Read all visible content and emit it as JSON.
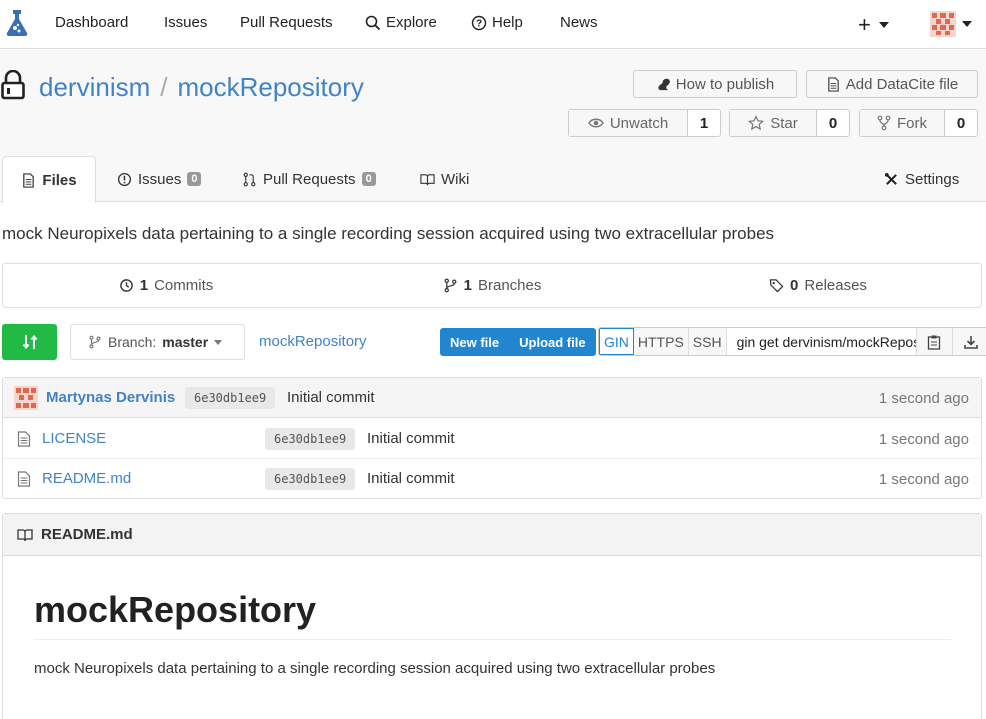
{
  "nav": {
    "items": [
      {
        "label": "Dashboard",
        "icon": ""
      },
      {
        "label": "Issues",
        "icon": ""
      },
      {
        "label": "Pull Requests",
        "icon": ""
      },
      {
        "label": "Explore",
        "icon": "search-icon"
      },
      {
        "label": "Help",
        "icon": "help-circle-icon"
      },
      {
        "label": "News",
        "icon": ""
      }
    ],
    "plus_label": "+"
  },
  "repo": {
    "owner": "dervinism",
    "separator": "/",
    "name": "mockRepository",
    "description": "mock Neuropixels data pertaining to a single recording session acquired using two extracellular probes"
  },
  "actions": {
    "publish_label": "How to publish",
    "datacite_label": "Add DataCite file",
    "unwatch_label": "Unwatch",
    "watch_count": "1",
    "star_label": "Star",
    "star_count": "0",
    "fork_label": "Fork",
    "fork_count": "0"
  },
  "tabs": {
    "files": "Files",
    "issues": "Issues",
    "issues_count": "0",
    "pulls": "Pull Requests",
    "pulls_count": "0",
    "wiki": "Wiki",
    "settings": "Settings"
  },
  "stats": {
    "commits_count": "1",
    "commits_label": "Commits",
    "branches_count": "1",
    "branches_label": "Branches",
    "releases_count": "0",
    "releases_label": "Releases"
  },
  "toolbar": {
    "branch_prefix": "Branch:",
    "branch_name": "master",
    "path": "mockRepository",
    "new_file": "New file",
    "upload_file": "Upload file",
    "protocols": [
      "GIN",
      "HTTPS",
      "SSH"
    ],
    "clone_url": "gin get dervinism/mockRepository"
  },
  "latest_commit": {
    "author": "Martynas Dervinis",
    "sha": "6e30db1ee9",
    "message": "Initial commit",
    "age": "1 second ago"
  },
  "files": [
    {
      "name": "LICENSE",
      "sha": "6e30db1ee9",
      "message": "Initial commit",
      "age": "1 second ago"
    },
    {
      "name": "README.md",
      "sha": "6e30db1ee9",
      "message": "Initial commit",
      "age": "1 second ago"
    }
  ],
  "readme": {
    "filename": "README.md",
    "heading": "mockRepository",
    "body": "mock Neuropixels data pertaining to a single recording session acquired using two extracellular probes"
  },
  "colors": {
    "link": "#4183c4",
    "primary": "#2185d0",
    "success": "#21ba45"
  }
}
